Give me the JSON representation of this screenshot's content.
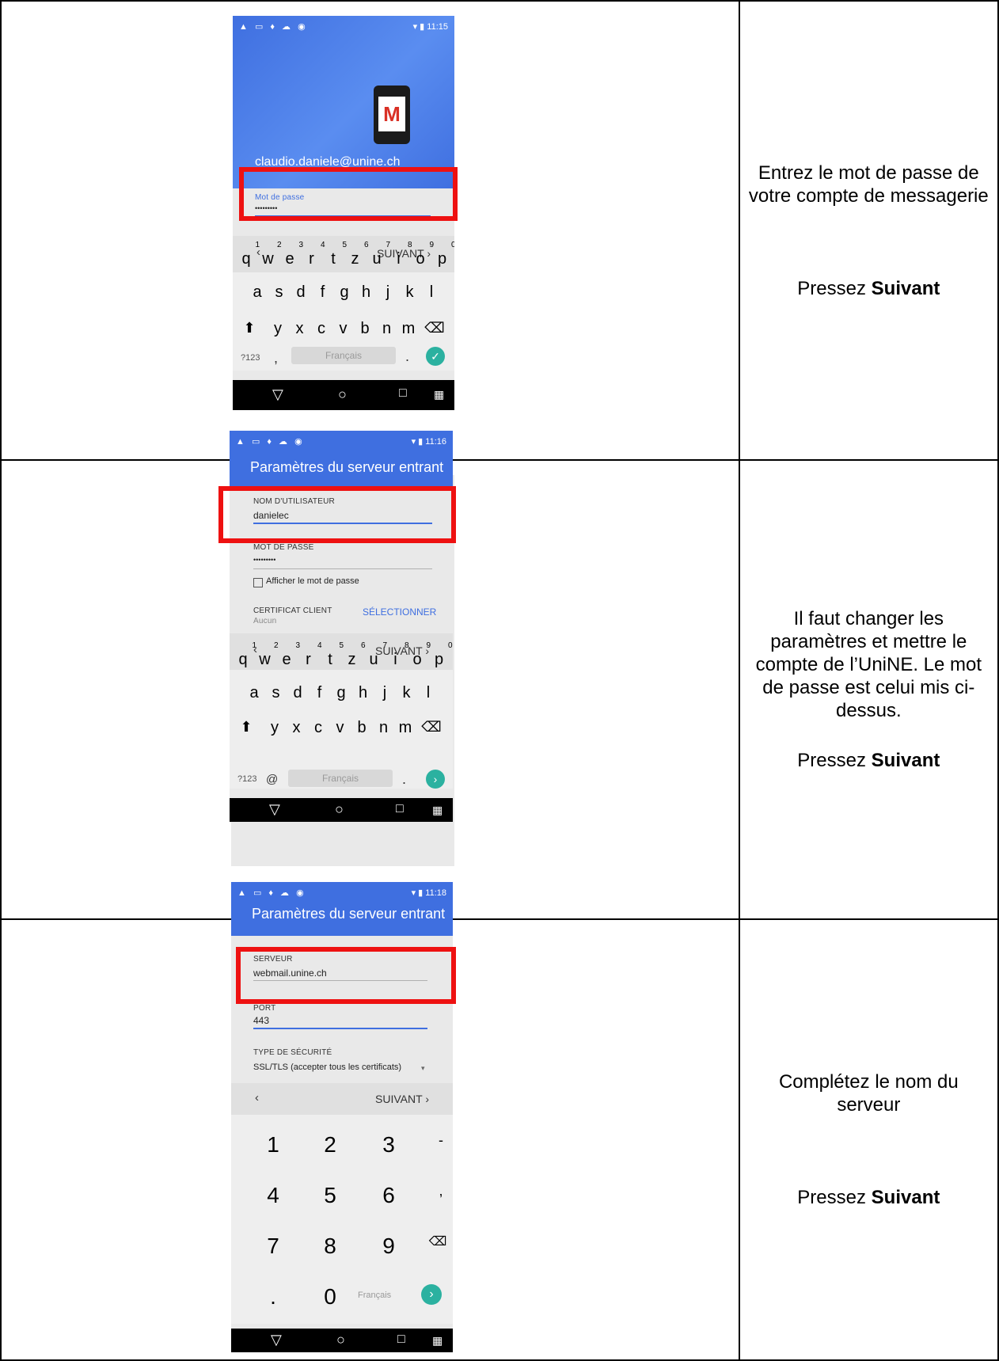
{
  "rows": [
    {
      "instruction": "Entrez le mot de passe de votre compte de messagerie",
      "press_prefix": "Pressez ",
      "press_bold": "Suivant",
      "phone": {
        "time": "11:15",
        "email": "claudio.daniele@unine.ch",
        "password_label": "Mot de passe",
        "password_value": "•••••••••",
        "next": "SUIVANT",
        "space": "Français",
        "sym": "?123",
        "comma": ","
      }
    },
    {
      "instruction": "Il faut changer les paramètres et mettre le compte de l’UniNE. Le mot de passe est celui mis ci-dessus.",
      "press_prefix": "Pressez ",
      "press_bold": "Suivant",
      "phone": {
        "time": "11:16",
        "title": "Paramètres du serveur entrant",
        "user_label": "NOM D'UTILISATEUR",
        "user_value": "danielec",
        "pass_label": "MOT DE PASSE",
        "pass_value": "•••••••••",
        "show_pass": "Afficher le mot de passe",
        "cert_label": "CERTIFICAT CLIENT",
        "cert_value": "Aucun",
        "select": "SÉLECTIONNER",
        "next": "SUIVANT",
        "space": "Français",
        "sym": "?123",
        "at": "@"
      }
    },
    {
      "instruction": "Complétez le nom du serveur",
      "press_prefix": "Pressez ",
      "press_bold": "Suivant",
      "phone": {
        "time": "11:18",
        "title": "Paramètres du serveur entrant",
        "server_label": "SERVEUR",
        "server_value": "webmail.unine.ch",
        "port_label": "PORT",
        "port_value": "443",
        "sec_label": "TYPE DE SÉCURITÉ",
        "sec_value": "SSL/TLS (accepter tous les certificats)",
        "next": "SUIVANT",
        "space": "Français"
      }
    }
  ],
  "keyboard": {
    "row1": [
      "q",
      "w",
      "e",
      "r",
      "t",
      "z",
      "u",
      "i",
      "o",
      "p"
    ],
    "row1_digits": [
      "1",
      "2",
      "3",
      "4",
      "5",
      "6",
      "7",
      "8",
      "9",
      "0"
    ],
    "row2": [
      "a",
      "s",
      "d",
      "f",
      "g",
      "h",
      "j",
      "k",
      "l"
    ],
    "row3": [
      "y",
      "x",
      "c",
      "v",
      "b",
      "n",
      "m"
    ],
    "numpad": [
      [
        "1",
        "2",
        "3",
        "-"
      ],
      [
        "4",
        "5",
        "6",
        ","
      ],
      [
        "7",
        "8",
        "9"
      ],
      [
        ".",
        "0"
      ]
    ]
  },
  "colors": {
    "accent": "#3f6fe0",
    "highlight": "#ee1111",
    "go": "#2bb1a0"
  }
}
